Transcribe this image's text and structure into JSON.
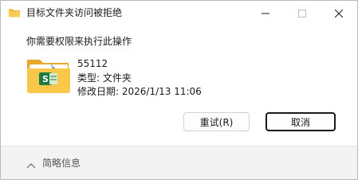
{
  "window": {
    "title": "目标文件夹访问被拒绝"
  },
  "dialog": {
    "message": "你需要权限来执行此操作",
    "item": {
      "name": "55112",
      "type_line": "类型: 文件夹",
      "modified_line": "修改日期: 2026/1/13 11:06"
    },
    "buttons": {
      "retry": "重试(R)",
      "cancel": "取消"
    },
    "details_toggle": "简略信息"
  },
  "icons": {
    "title": "folder-icon",
    "minimize": "minimize-icon",
    "maximize": "maximize-icon",
    "close": "close-icon",
    "item": "folder-with-excel-icon",
    "details": "chevron-up-icon"
  },
  "colors": {
    "folder": "#f5c13d",
    "excel_green": "#1d7a43",
    "accent_border": "#1a1a1a"
  }
}
